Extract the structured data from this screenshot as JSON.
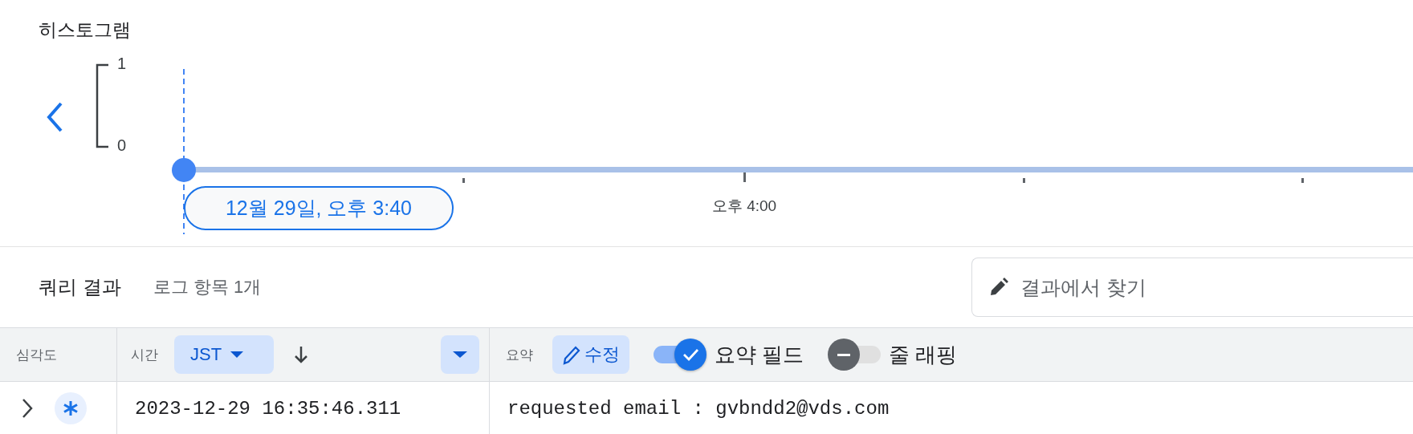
{
  "histogram": {
    "title": "히스토그램",
    "y_ticks": [
      "1",
      "0"
    ],
    "x_tick_labels": [
      "오후 4:00"
    ],
    "selected_time": "12월 29일, 오후 3:40"
  },
  "query_results": {
    "title": "쿼리 결과",
    "count": "로그 항목 1개",
    "search": {
      "placeholder": "결과에서 찾기"
    }
  },
  "table": {
    "columns": [
      {
        "label": "심각도"
      },
      {
        "label": "시간",
        "timezone": "JST"
      },
      {
        "label": "요약",
        "edit_label": "수정"
      }
    ],
    "toggles": [
      {
        "label": "요약 필드",
        "on": true
      },
      {
        "label": "줄 래핑",
        "on": false
      }
    ],
    "rows": [
      {
        "expanded": false,
        "time": "2023-12-29 16:35:46.311",
        "summary": "requested email : gvbndd2@vds.com"
      }
    ]
  }
}
